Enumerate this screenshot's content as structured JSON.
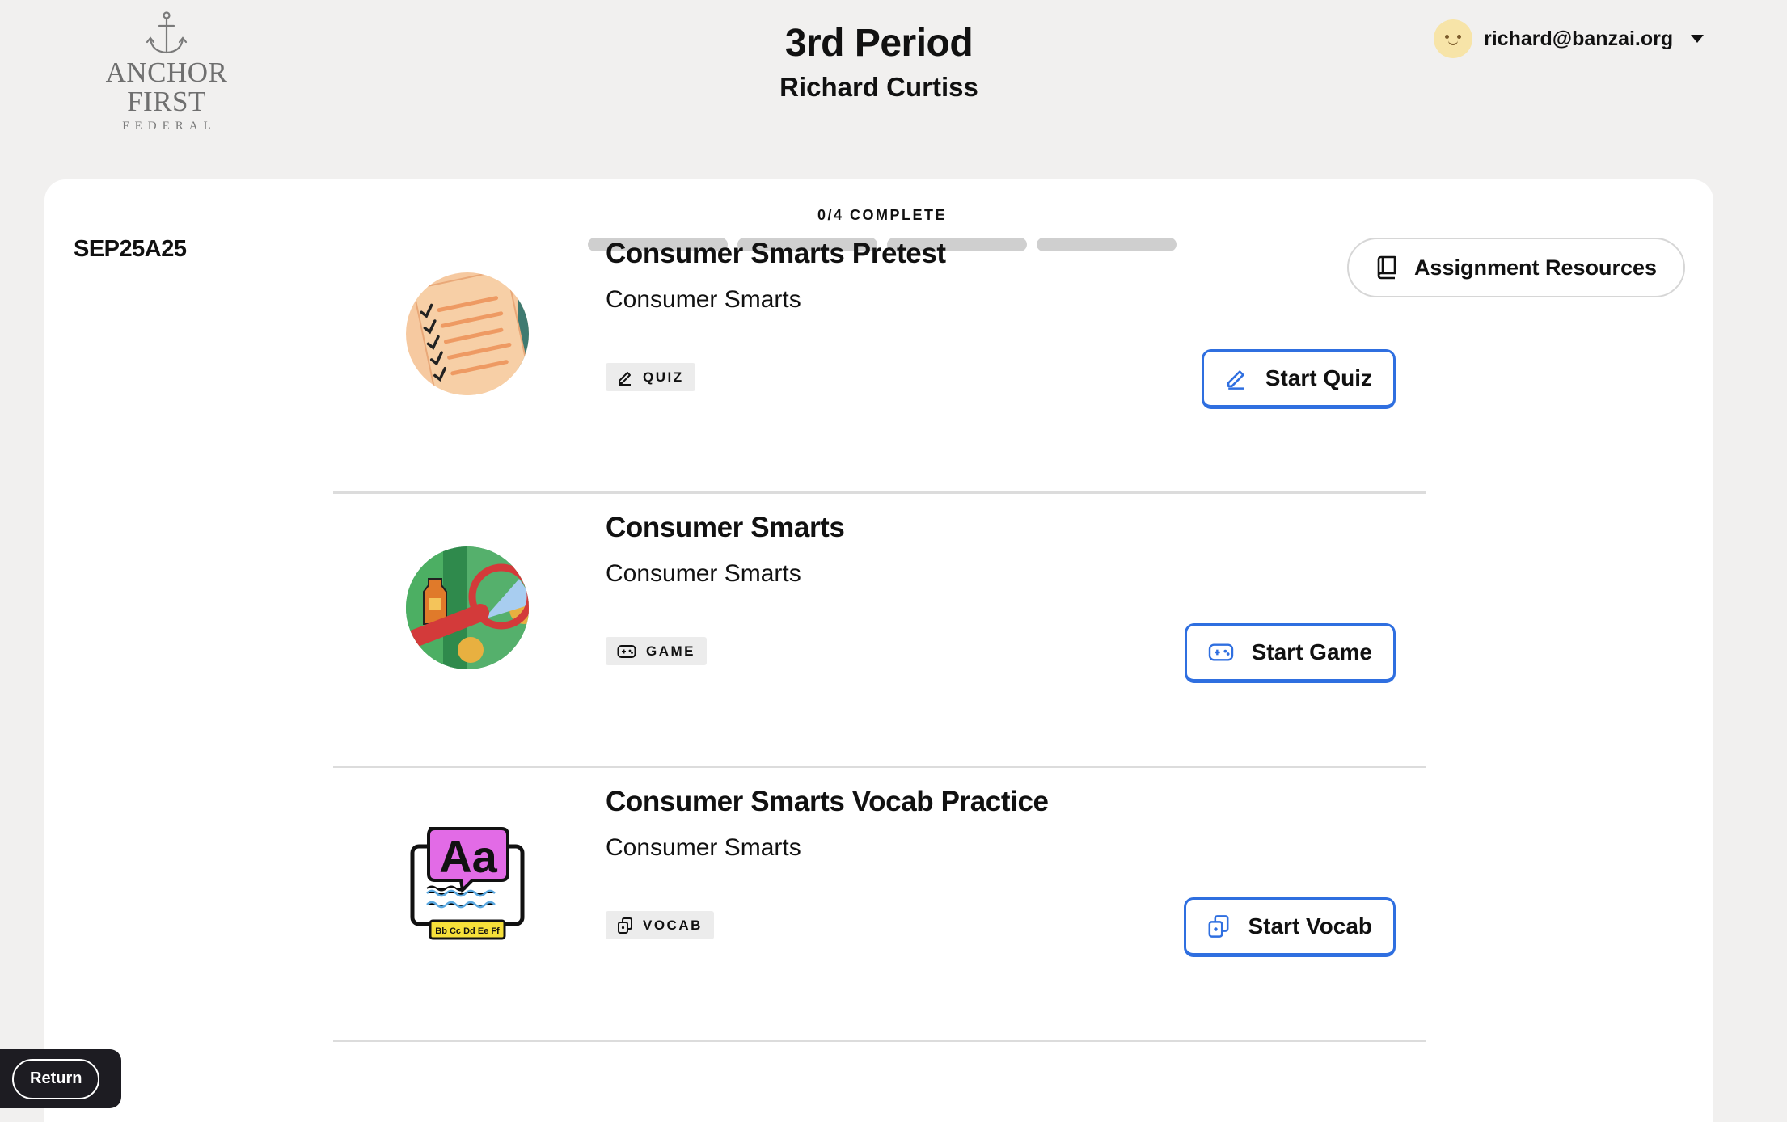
{
  "brand": {
    "name": "ANCHOR FIRST",
    "sub": "FEDERAL"
  },
  "header": {
    "class_title": "3rd Period",
    "teacher_name": "Richard Curtiss"
  },
  "user": {
    "email": "richard@banzai.org"
  },
  "assignment": {
    "code": "SEP25A25",
    "progress_label": "0/4 COMPLETE",
    "progress": {
      "completed": 0,
      "total": 4
    },
    "resources_label": "Assignment Resources"
  },
  "activities": [
    {
      "title": "Consumer Smarts Pretest",
      "subtitle": "Consumer Smarts",
      "tag": "QUIZ",
      "button": "Start Quiz"
    },
    {
      "title": "Consumer Smarts",
      "subtitle": "Consumer Smarts",
      "tag": "GAME",
      "button": "Start Game"
    },
    {
      "title": "Consumer Smarts Vocab Practice",
      "subtitle": "Consumer Smarts",
      "tag": "VOCAB",
      "button": "Start Vocab",
      "thumb_text": {
        "main": "Aa",
        "sub": "Bb Cc Dd Ee Ff"
      }
    }
  ],
  "footer": {
    "return_label": "Return"
  },
  "colors": {
    "accent": "#2f6fe0",
    "background": "#f1f0ef",
    "card": "#ffffff",
    "return_bar": "#1d1c22"
  }
}
